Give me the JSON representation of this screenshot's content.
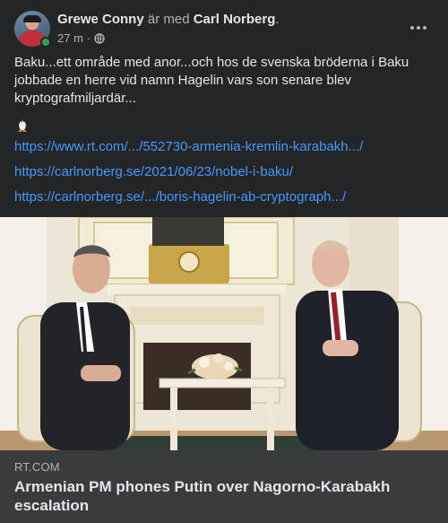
{
  "header": {
    "author": "Grewe Conny",
    "with_text": "är med",
    "tagged": "Carl Norberg",
    "period": ".",
    "time": "27 m",
    "dot": "·",
    "privacy_icon": "globe-icon",
    "more_icon": "more-horizontal-icon"
  },
  "post": {
    "text": "Baku...ett område med anor...och hos de svenska bröderna i Baku jobbade en herre vid namn Hagelin vars son senare blev kryptografmiljardär...",
    "emoji_icon": "penguin-icon",
    "links": [
      "https://www.rt.com/.../552730-armenia-kremlin-karabakh.../",
      "https://carlnorberg.se/2021/06/23/nobel-i-baku/",
      "https://carlnorberg.se/.../boris-hagelin-ab-cryptograph.../"
    ]
  },
  "link_preview": {
    "domain": "RT.COM",
    "title": "Armenian PM phones Putin over Nagorno-Karabakh escalation"
  },
  "colors": {
    "background": "#242526",
    "preview_background": "#3a3b3c",
    "link": "#4599ff",
    "text": "#e4e6eb",
    "muted": "#b0b3b8",
    "online": "#31a24c"
  }
}
